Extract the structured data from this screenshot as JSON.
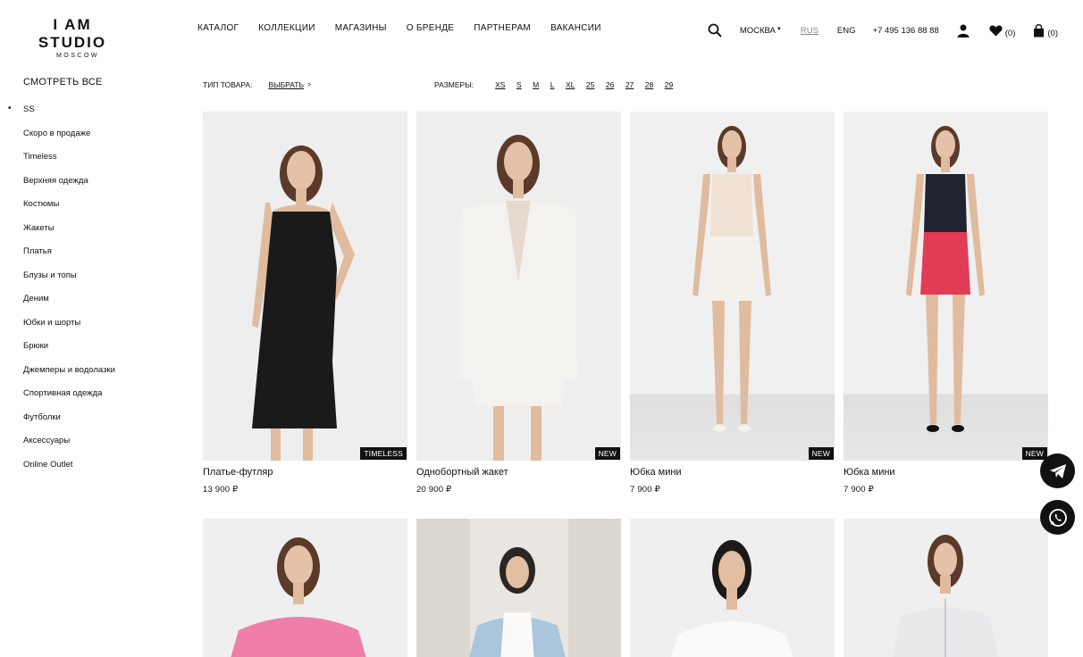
{
  "brand": {
    "logo_main": "I AM STUDIO",
    "logo_sub": "MOSCOW"
  },
  "nav": [
    "КАТАЛОГ",
    "КОЛЛЕКЦИИ",
    "МАГАЗИНЫ",
    "О БРЕНДЕ",
    "ПАРТНЕРАМ",
    "ВАКАНСИИ"
  ],
  "header": {
    "city": "МОСКВА",
    "lang_rus": "RUS",
    "lang_eng": "ENG",
    "phone": "+7 495 136 88 88",
    "favorites_count": "(0)",
    "cart_count": "(0)"
  },
  "sidebar": {
    "all_label": "СМОТРЕТЬ ВСЕ",
    "items": [
      "SS",
      "Скоро в продаже",
      "Timeless",
      "Верхняя одежда",
      "Костюмы",
      "Жакеты",
      "Платья",
      "Блузы и топы",
      "Деним",
      "Юбки и шорты",
      "Брюки",
      "Джемперы и водолазки",
      "Спортивная одежда",
      "Футболки",
      "Аксессуары",
      "Online Outlet"
    ],
    "active_index": 0
  },
  "filter": {
    "type_label": "ТИП ТОВАРА:",
    "type_value": "ВЫБРАТЬ",
    "sizes_label": "РАЗМЕРЫ:",
    "sizes": [
      "XS",
      "S",
      "M",
      "L",
      "XL",
      "25",
      "26",
      "27",
      "28",
      "29"
    ]
  },
  "products": [
    {
      "name": "Платье-футляр",
      "price": "13 900 ₽",
      "badge": "TIMELESS",
      "color": "#1a1a1a"
    },
    {
      "name": "Однобортный жакет",
      "price": "20 900 ₽",
      "badge": "NEW",
      "color": "#f4f2ee"
    },
    {
      "name": "Юбка мини",
      "price": "7 900 ₽",
      "badge": "NEW",
      "color": "#f3f1ea"
    },
    {
      "name": "Юбка мини",
      "price": "7 900 ₽",
      "badge": "NEW",
      "color": "#e23b55"
    }
  ],
  "colors": {
    "text": "#111111",
    "muted": "#888888",
    "badge_bg": "#111111",
    "photo_bg": "#eeeeee"
  }
}
